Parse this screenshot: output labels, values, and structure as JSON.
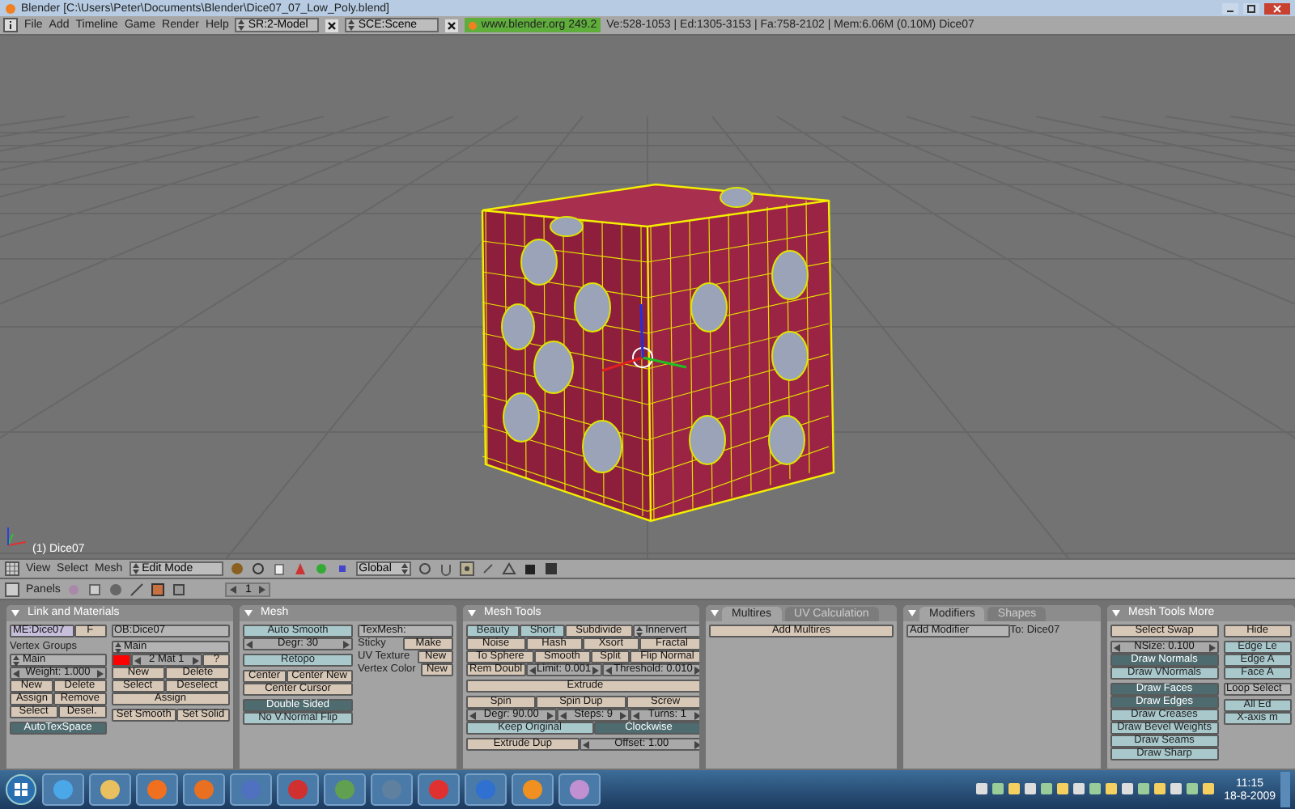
{
  "window": {
    "title": "Blender [C:\\Users\\Peter\\Documents\\Blender\\Dice07_07_Low_Poly.blend]"
  },
  "menu_bar": {
    "menus": [
      "File",
      "Add",
      "Timeline",
      "Game",
      "Render",
      "Help"
    ],
    "screen": "SR:2-Model",
    "scene": "SCE:Scene",
    "version": "www.blender.org 249.2",
    "stats": "Ve:528-1053 | Ed:1305-3153 | Fa:758-2102 | Mem:6.06M (0.10M) Dice07"
  },
  "viewport": {
    "object_label": "(1) Dice07"
  },
  "view3d_header": {
    "menus": [
      "View",
      "Select",
      "Mesh"
    ],
    "mode": "Edit Mode",
    "orientation": "Global"
  },
  "buttons_header": {
    "label": "Panels",
    "frame": "1"
  },
  "panels": [
    {
      "title": "Link and Materials",
      "columns": [
        [
          [
            [
              {
                "kind": "idfield",
                "text": "ME:Dice07"
              },
              {
                "kind": "button",
                "text": "F"
              }
            ]
          ],
          [
            [
              {
                "kind": "label",
                "text": "Vertex Groups"
              }
            ],
            [
              {
                "kind": "menu",
                "text": "Main"
              }
            ],
            [
              {
                "kind": "number",
                "text": "Weight: 1.000"
              }
            ],
            [
              {
                "kind": "button",
                "text": "New"
              },
              {
                "kind": "button",
                "text": "Delete"
              }
            ],
            [
              {
                "kind": "button",
                "text": "Assign"
              },
              {
                "kind": "button",
                "text": "Remove"
              }
            ],
            [
              {
                "kind": "button",
                "text": "Select"
              },
              {
                "kind": "button",
                "text": "Desel."
              }
            ]
          ],
          [
            [
              {
                "kind": "toggle",
                "text": "AutoTexSpace",
                "on": true
              }
            ]
          ]
        ],
        [
          [
            [
              {
                "kind": "field",
                "text": "OB:Dice07"
              }
            ]
          ],
          [
            [
              {
                "kind": "menu",
                "text": "Main"
              }
            ],
            [
              {
                "kind": "swatch",
                "color": "#ff0000"
              },
              {
                "kind": "number",
                "text": "2 Mat 1"
              },
              {
                "kind": "button",
                "text": "?"
              }
            ],
            [
              {
                "kind": "button",
                "text": "New"
              },
              {
                "kind": "button",
                "text": "Delete"
              }
            ],
            [
              {
                "kind": "button",
                "text": "Select"
              },
              {
                "kind": "button",
                "text": "Deselect"
              }
            ],
            [
              {
                "kind": "button",
                "text": "Assign"
              }
            ]
          ],
          [
            [
              {
                "kind": "button",
                "text": "Set Smooth"
              },
              {
                "kind": "button",
                "text": "Set Solid"
              }
            ]
          ]
        ]
      ]
    },
    {
      "title": "Mesh",
      "columns": [
        [
          [
            [
              {
                "kind": "toggle",
                "text": "Auto Smooth",
                "on": false
              }
            ],
            [
              {
                "kind": "number",
                "text": "Degr: 30"
              }
            ]
          ],
          [
            [
              {
                "kind": "toggle",
                "text": "Retopo",
                "on": false
              }
            ]
          ],
          [
            [
              {
                "kind": "button",
                "text": "Center"
              },
              {
                "kind": "button",
                "text": "Center New"
              }
            ],
            [
              {
                "kind": "button",
                "text": "Center Cursor"
              }
            ]
          ],
          [
            [
              {
                "kind": "toggle",
                "text": "Double Sided",
                "on": true
              }
            ],
            [
              {
                "kind": "toggle",
                "text": "No V.Normal Flip",
                "on": false
              }
            ]
          ]
        ],
        [
          [
            [
              {
                "kind": "field",
                "text": "TexMesh:"
              }
            ],
            [
              {
                "kind": "label",
                "text": "Sticky"
              },
              {
                "kind": "button",
                "text": "Make"
              }
            ],
            [
              {
                "kind": "label",
                "text": "UV Texture"
              },
              {
                "kind": "button",
                "text": "New"
              }
            ],
            [
              {
                "kind": "label",
                "text": "Vertex Color"
              },
              {
                "kind": "button",
                "text": "New"
              }
            ]
          ]
        ]
      ]
    },
    {
      "title": "Mesh Tools",
      "columns": [
        [
          [
            [
              {
                "kind": "toggle",
                "text": "Beauty",
                "on": false
              },
              {
                "kind": "toggle",
                "text": "Short",
                "on": false
              },
              {
                "kind": "button",
                "text": "Subdivide"
              },
              {
                "kind": "menu",
                "text": "Innervert"
              }
            ],
            [
              {
                "kind": "button",
                "text": "Noise"
              },
              {
                "kind": "button",
                "text": "Hash"
              },
              {
                "kind": "button",
                "text": "Xsort"
              },
              {
                "kind": "button",
                "text": "Fractal"
              }
            ],
            [
              {
                "kind": "button",
                "text": "To Sphere"
              },
              {
                "kind": "button",
                "text": "Smooth"
              },
              {
                "kind": "button",
                "text": "Split"
              },
              {
                "kind": "button",
                "text": "Flip Normal"
              }
            ],
            [
              {
                "kind": "button",
                "text": "Rem Doubl"
              },
              {
                "kind": "number",
                "text": "Limit: 0.001"
              },
              {
                "kind": "number",
                "text": "Threshold: 0.010"
              }
            ]
          ],
          [
            [
              {
                "kind": "button",
                "text": "Extrude"
              }
            ]
          ],
          [
            [
              {
                "kind": "button",
                "text": "Spin"
              },
              {
                "kind": "button",
                "text": "Spin Dup"
              },
              {
                "kind": "button",
                "text": "Screw"
              }
            ],
            [
              {
                "kind": "number",
                "text": "Degr: 90.00"
              },
              {
                "kind": "number",
                "text": "Steps: 9"
              },
              {
                "kind": "number",
                "text": "Turns: 1"
              }
            ],
            [
              {
                "kind": "toggle",
                "text": "Keep Original",
                "on": false
              },
              {
                "kind": "toggle",
                "text": "Clockwise",
                "on": true
              }
            ]
          ],
          [
            [
              {
                "kind": "button",
                "text": "Extrude Dup"
              },
              {
                "kind": "number",
                "text": "Offset: 1.00"
              }
            ]
          ]
        ]
      ]
    },
    {
      "tabs": [
        {
          "label": "Multires",
          "selected": true
        },
        {
          "label": "UV Calculation",
          "selected": false
        }
      ],
      "columns": [
        [
          [
            [
              {
                "kind": "button",
                "text": "Add Multires"
              }
            ]
          ]
        ]
      ]
    },
    {
      "tabs": [
        {
          "label": "Modifiers",
          "selected": true
        },
        {
          "label": "Shapes",
          "selected": false
        }
      ],
      "columns": [
        [
          [
            [
              {
                "kind": "field",
                "text": "Add Modifier"
              },
              {
                "kind": "label",
                "text": "To: Dice07"
              }
            ]
          ]
        ]
      ]
    },
    {
      "title": "Mesh Tools More",
      "columns": [
        [
          [
            [
              {
                "kind": "button",
                "text": "Select Swap"
              }
            ]
          ],
          [
            [
              {
                "kind": "number",
                "text": "NSize: 0.100"
              }
            ],
            [
              {
                "kind": "toggle",
                "text": "Draw Normals",
                "on": true
              }
            ],
            [
              {
                "kind": "toggle",
                "text": "Draw VNormals",
                "on": false
              }
            ]
          ],
          [
            [
              {
                "kind": "toggle",
                "text": "Draw Faces",
                "on": true
              }
            ],
            [
              {
                "kind": "toggle",
                "text": "Draw Edges",
                "on": true
              }
            ],
            [
              {
                "kind": "toggle",
                "text": "Draw Creases",
                "on": false
              }
            ],
            [
              {
                "kind": "toggle",
                "text": "Draw Bevel Weights",
                "on": false
              }
            ],
            [
              {
                "kind": "toggle",
                "text": "Draw Seams",
                "on": false
              }
            ],
            [
              {
                "kind": "toggle",
                "text": "Draw Sharp",
                "on": false
              }
            ]
          ]
        ],
        [
          [
            [
              {
                "kind": "button",
                "text": "Hide"
              }
            ]
          ],
          [
            [
              {
                "kind": "toggle",
                "text": "Edge Le",
                "on": false
              }
            ],
            [
              {
                "kind": "toggle",
                "text": "Edge A",
                "on": false
              }
            ],
            [
              {
                "kind": "toggle",
                "text": "Face A",
                "on": false
              }
            ]
          ],
          [
            [
              {
                "kind": "field",
                "text": "Loop Select"
              }
            ]
          ],
          [
            [
              {
                "kind": "toggle",
                "text": "All Ed",
                "on": false
              }
            ],
            [
              {
                "kind": "toggle",
                "text": "X-axis m",
                "on": false
              }
            ]
          ]
        ]
      ]
    }
  ],
  "taskbar": {
    "time": "11:15",
    "date": "18-8-2009"
  }
}
